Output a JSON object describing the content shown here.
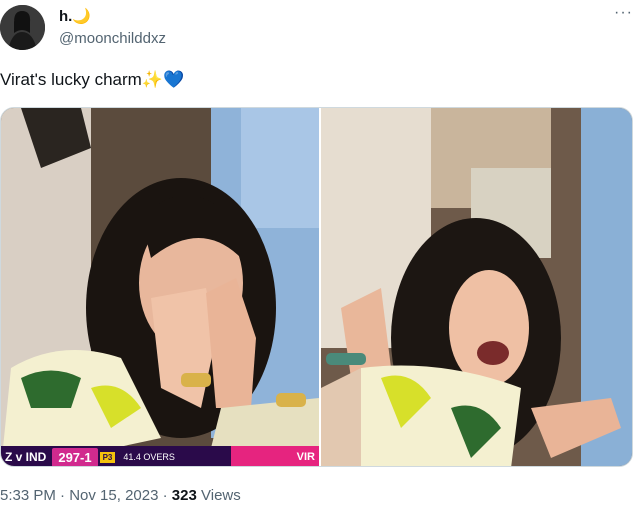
{
  "tweet": {
    "author_name": "h.🌙",
    "author_handle": "@moonchilddxz",
    "more_glyph": "···",
    "text": "Virat's lucky charm✨💙",
    "time": "5:33 PM",
    "dot1": "·",
    "date": "Nov 15, 2023",
    "dot2": "·",
    "views_count": "323",
    "views_label": "Views"
  },
  "scoreboard": {
    "team_prefix": "Z v IND",
    "runs": "297-1",
    "powerplay": "P3",
    "overs": "41.4 OVERS",
    "right_text": "VIR"
  },
  "colors": {
    "text_primary": "#0f1419",
    "text_secondary": "#536471",
    "score_bg": "#2a0a4a",
    "score_accent": "#d12a8e"
  }
}
